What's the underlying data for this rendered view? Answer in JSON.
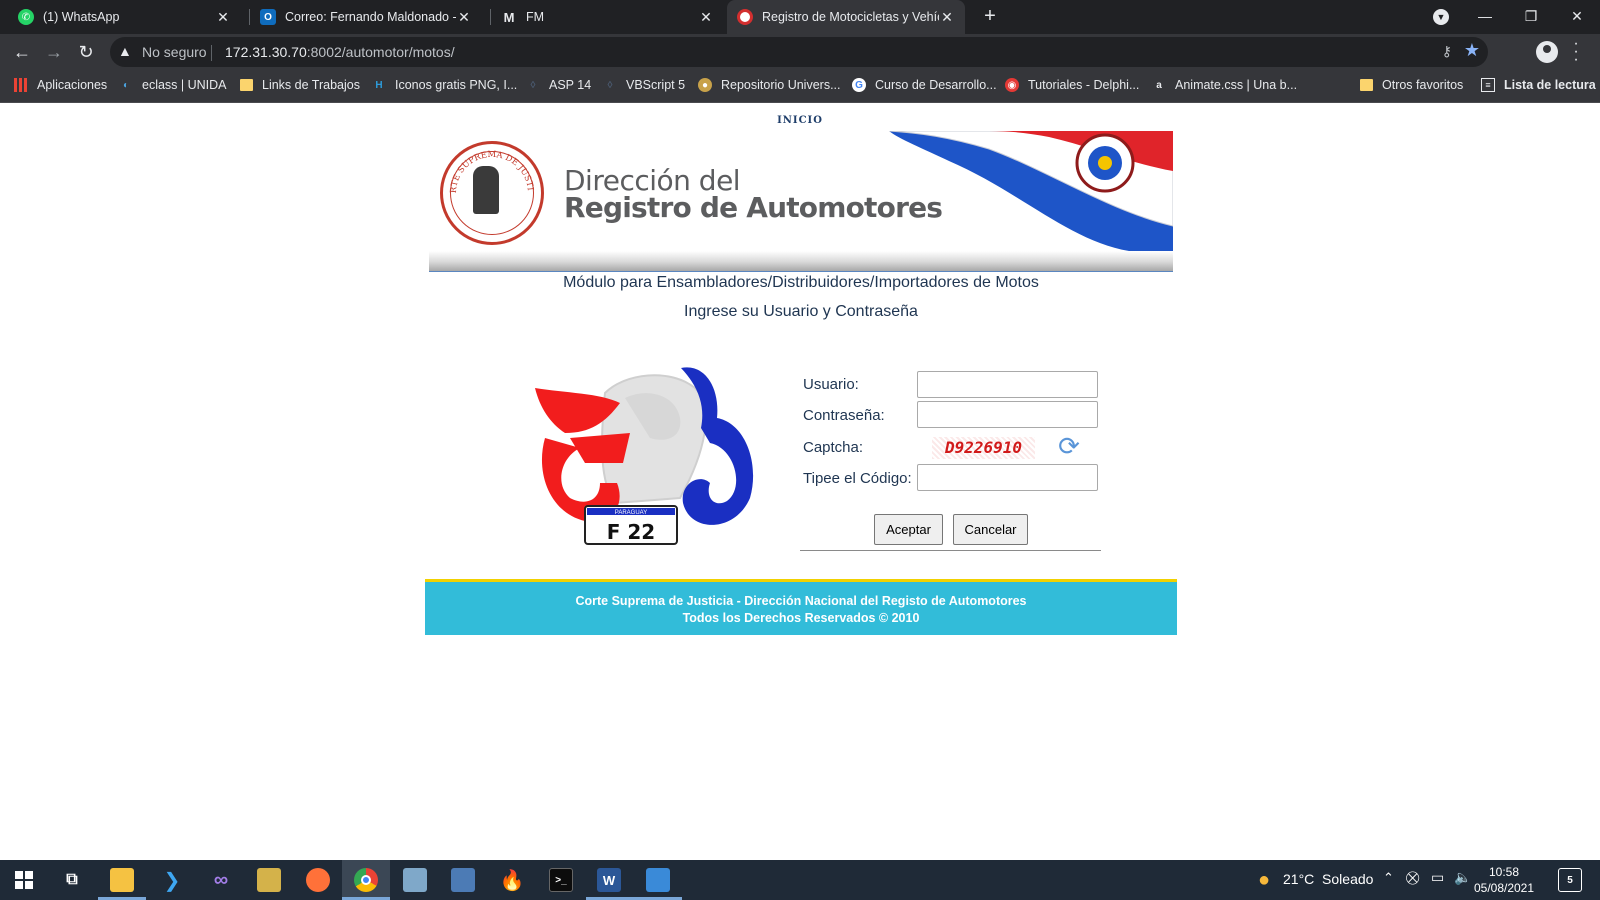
{
  "browser": {
    "tabs": [
      {
        "title": "(1) WhatsApp",
        "icon": "whatsapp-icon",
        "color": "#25d366",
        "active": false
      },
      {
        "title": "Correo: Fernando Maldonado - C",
        "icon": "outlook-icon",
        "color": "#0f6cbd",
        "active": false
      },
      {
        "title": "FM",
        "icon": "gmail-icon",
        "color": "#e8eaed",
        "active": false
      },
      {
        "title": "Registro de Motocicletas y Vehícu",
        "icon": "site-seal-icon",
        "color": "#d32f2f",
        "active": true
      }
    ],
    "omnibox": {
      "security": "No seguro",
      "host": "172.31.30.70",
      "path": ":8002/automotor/motos/"
    },
    "bookmarks": [
      {
        "label": "Aplicaciones",
        "icon": "apps-grid-icon",
        "color": "#ea4335"
      },
      {
        "label": "eclass | UNIDA",
        "icon": "eclass-icon",
        "color": "#4aa3df"
      },
      {
        "label": "Links de Trabajos",
        "icon": "folder-icon",
        "color": "#fbd46d"
      },
      {
        "label": "Iconos gratis PNG, I...",
        "icon": "iconos-icon",
        "color": "#2d9cdb"
      },
      {
        "label": "ASP 14",
        "icon": "asp-icon",
        "color": "#4a5a70"
      },
      {
        "label": "VBScript 5",
        "icon": "vbscript-icon",
        "color": "#4a5a70"
      },
      {
        "label": "Repositorio Univers...",
        "icon": "repositorio-icon",
        "color": "#c8a24a"
      },
      {
        "label": "Curso de Desarrollo...",
        "icon": "google-icon",
        "color": "#ffffff"
      },
      {
        "label": "Tutoriales - Delphi...",
        "icon": "delphi-icon",
        "color": "#e53935"
      },
      {
        "label": "Animate.css | Una b...",
        "icon": "animate-icon",
        "color": "#35363a"
      },
      {
        "label": "Otros favoritos",
        "icon": "folder-icon",
        "color": "#fbd46d"
      },
      {
        "label": "Lista de lectura",
        "icon": "reading-list-icon",
        "color": "#e8eaed"
      }
    ]
  },
  "page": {
    "nav_inicio": "INICIO",
    "banner": {
      "line1": "Dirección del",
      "line2": "Registro de Automotores",
      "seal_text": "CORTE SUPREMA DE JUSTICIA",
      "seal_subtext": "REPÚBLICA DEL PARAGUAY"
    },
    "module_title": "Módulo para Ensambladores/Distribuidores/Importadores de Motos",
    "instruction": "Ingrese su Usuario y Contraseña",
    "plate": {
      "country": "PARAGUAY",
      "number": "F 22"
    },
    "form": {
      "usuario_label": "Usuario:",
      "usuario_value": "",
      "password_label": "Contraseña:",
      "password_value": "",
      "captcha_label": "Captcha:",
      "captcha_code": "D9226910",
      "codigo_label": "Tipee el Código:",
      "codigo_value": "",
      "accept_label": "Aceptar",
      "cancel_label": "Cancelar"
    },
    "footer": {
      "line1": "Corte Suprema de Justicia - Dirección Nacional del Registo de Automotores",
      "line2": "Todos los Derechos Reservados © 2010"
    },
    "colors": {
      "footer_bg": "#32bcd9",
      "footer_border": "#f1d100",
      "text_dark_blue": "#1f3551",
      "flag_red": "#d52b1e",
      "flag_blue": "#0038a8"
    }
  },
  "taskbar": {
    "apps": [
      "start-icon",
      "task-view-icon",
      "file-explorer-icon",
      "vscode-icon",
      "visual-studio-icon",
      "app-icon",
      "firefox-icon",
      "chrome-icon",
      "app2-icon",
      "app3-icon",
      "firebird-icon",
      "terminal-icon",
      "word-icon",
      "photos-icon"
    ],
    "weather": "21°C  Soleado",
    "time": "10:58",
    "date": "05/08/2021",
    "notifications": "5"
  }
}
